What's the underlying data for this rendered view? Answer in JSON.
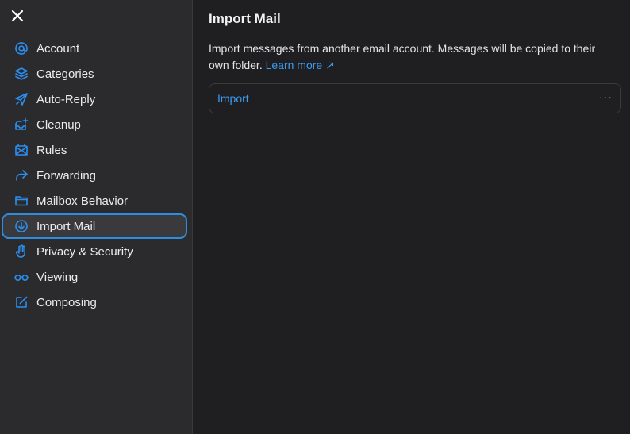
{
  "sidebar": {
    "close_label": "Close",
    "items": [
      {
        "label": "Account",
        "icon": "at-icon"
      },
      {
        "label": "Categories",
        "icon": "layers-icon"
      },
      {
        "label": "Auto-Reply",
        "icon": "paper-plane-icon"
      },
      {
        "label": "Cleanup",
        "icon": "inbox-sparkle-icon"
      },
      {
        "label": "Rules",
        "icon": "mail-rules-icon"
      },
      {
        "label": "Forwarding",
        "icon": "forward-arrow-icon"
      },
      {
        "label": "Mailbox Behavior",
        "icon": "folder-icon"
      },
      {
        "label": "Import Mail",
        "icon": "download-circle-icon",
        "active": true
      },
      {
        "label": "Privacy & Security",
        "icon": "hand-icon"
      },
      {
        "label": "Viewing",
        "icon": "glasses-icon"
      },
      {
        "label": "Composing",
        "icon": "compose-icon"
      }
    ]
  },
  "main": {
    "title": "Import Mail",
    "description": "Import messages from another email account. Messages will be copied to their own folder.",
    "learn_more": "Learn more ↗",
    "import_row": {
      "label": "Import",
      "more": "···"
    }
  },
  "colors": {
    "accent": "#2a8ff0",
    "sidebar_bg": "#2b2b2e",
    "main_bg": "#1f1f21",
    "active_border": "#2f8de0"
  }
}
